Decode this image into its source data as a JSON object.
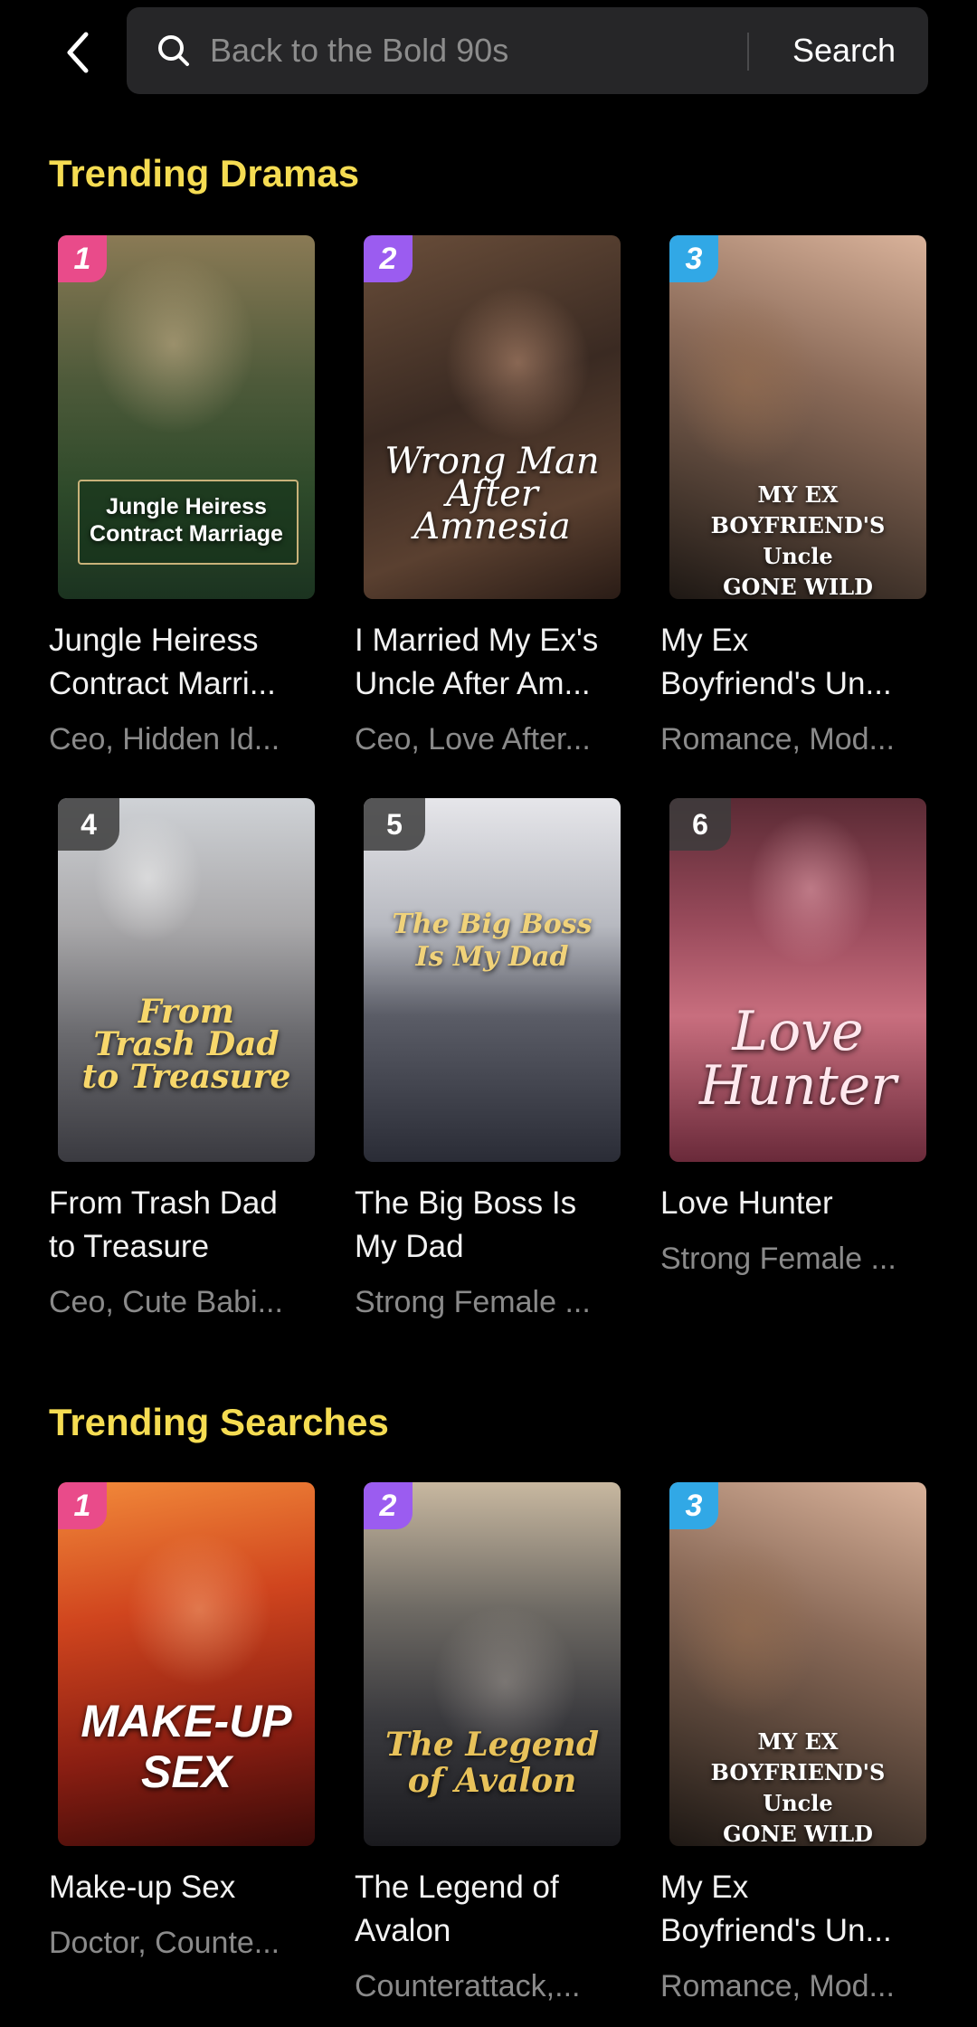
{
  "header": {
    "search_placeholder": "Back to the Bold 90s",
    "search_button": "Search"
  },
  "trending_dramas": {
    "title": "Trending Dramas",
    "items": [
      {
        "rank": "1",
        "poster_text": "Jungle Heiress\nContract Marriage",
        "title": "Jungle Heiress\nContract Marri...",
        "tags": "Ceo, Hidden Id..."
      },
      {
        "rank": "2",
        "poster_text": "Wrong Man\nAfter\nAmnesia",
        "title": "I Married My Ex's\nUncle After Am...",
        "tags": "Ceo, Love After..."
      },
      {
        "rank": "3",
        "poster_text": "MY EX BOYFRIEND'S\nUncle\nGONE WILD",
        "title": "My Ex\nBoyfriend's Un...",
        "tags": "Romance, Mod..."
      },
      {
        "rank": "4",
        "poster_text": "From\nTrash Dad\nto Treasure",
        "title": "From Trash Dad\nto Treasure",
        "tags": "Ceo, Cute Babi..."
      },
      {
        "rank": "5",
        "poster_text": "The Big Boss\nIs My Dad",
        "title": "The Big Boss Is\nMy Dad",
        "tags": "Strong Female ..."
      },
      {
        "rank": "6",
        "poster_text": "Love\nHunter",
        "title": "Love Hunter",
        "tags": "Strong Female ..."
      }
    ]
  },
  "trending_searches": {
    "title": "Trending Searches",
    "items": [
      {
        "rank": "1",
        "poster_text": "MAKE-UP\nSEX",
        "title": "Make-up Sex",
        "tags": "Doctor, Counte..."
      },
      {
        "rank": "2",
        "poster_text": "The Legend\nof Avalon",
        "title": "The Legend of\nAvalon",
        "tags": "Counterattack,..."
      },
      {
        "rank": "3",
        "poster_text": "MY EX BOYFRIEND'S\nUncle\nGONE WILD",
        "title": "My Ex\nBoyfriend's Un...",
        "tags": "Romance, Mod..."
      }
    ]
  },
  "colors": {
    "accent_yellow": "#f5dc52",
    "rank1": "#e94b8a",
    "rank2": "#9b5cf0",
    "rank3": "#31a8e6"
  }
}
